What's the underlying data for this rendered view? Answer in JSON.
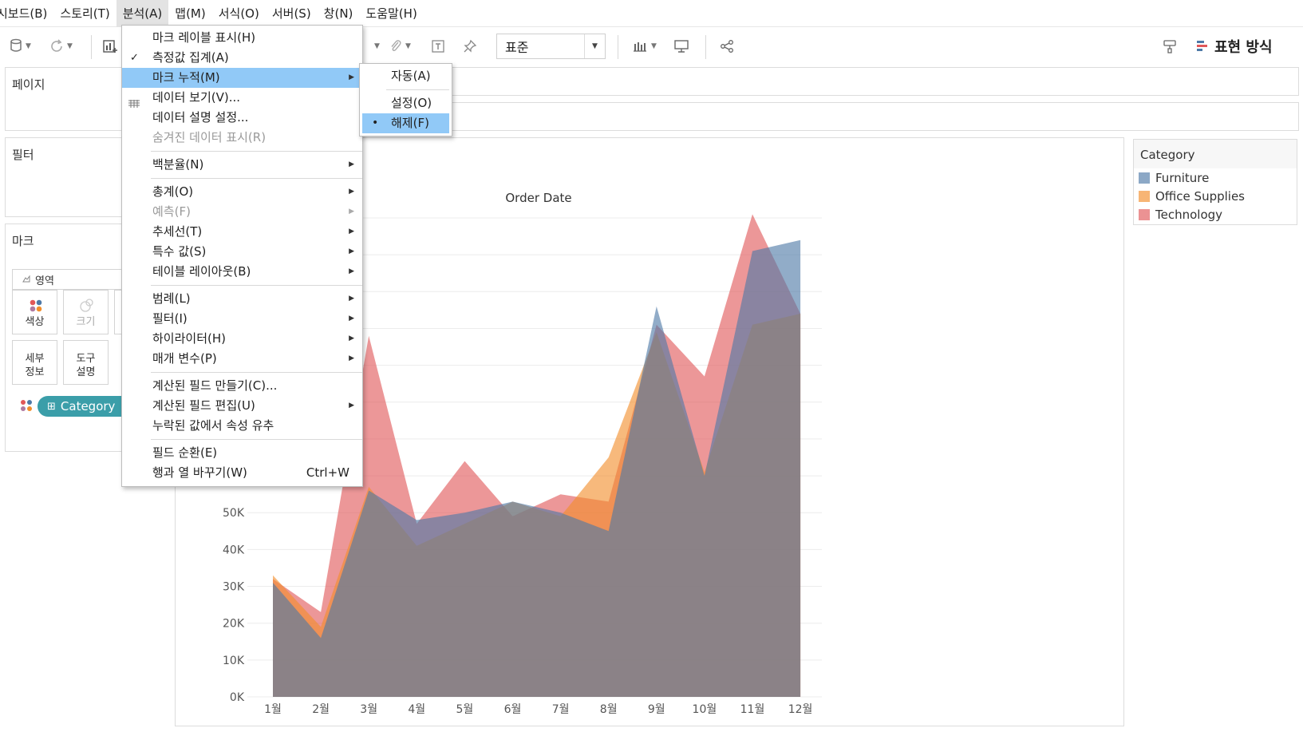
{
  "menubar": {
    "items": [
      {
        "label": "시보드(B)"
      },
      {
        "label": "스토리(T)"
      },
      {
        "label": "분석(A)"
      },
      {
        "label": "맵(M)"
      },
      {
        "label": "서식(O)"
      },
      {
        "label": "서버(S)"
      },
      {
        "label": "창(N)"
      },
      {
        "label": "도움말(H)"
      }
    ]
  },
  "toolbar": {
    "mark_size_select": "표준",
    "present_label": "표현 방식"
  },
  "panes": {
    "pages_title": "페이지",
    "filters_title": "필터",
    "marks_title": "마크",
    "mark_type": "영역",
    "cards": [
      {
        "label": "색상"
      },
      {
        "label": "크기"
      },
      {
        "label": "세부 정보"
      },
      {
        "label": "도구 설명"
      }
    ],
    "category_pill": "Category"
  },
  "analysis_menu": {
    "items": [
      {
        "label": "마크 레이블 표시(H)"
      },
      {
        "label": "측정값 집계(A)"
      },
      {
        "label": "마크 누적(M)"
      },
      {
        "label": "데이터 보기(V)..."
      },
      {
        "label": "데이터 설명 설정..."
      },
      {
        "label": "숨겨진 데이터 표시(R)"
      },
      {
        "label": "백분율(N)"
      },
      {
        "label": "총계(O)"
      },
      {
        "label": "예측(F)"
      },
      {
        "label": "추세선(T)"
      },
      {
        "label": "특수 값(S)"
      },
      {
        "label": "테이블 레이아웃(B)"
      },
      {
        "label": "범례(L)"
      },
      {
        "label": "필터(I)"
      },
      {
        "label": "하이라이터(H)"
      },
      {
        "label": "매개 변수(P)"
      },
      {
        "label": "계산된 필드 만들기(C)..."
      },
      {
        "label": "계산된 필드 편집(U)"
      },
      {
        "label": "누락된 값에서 속성 유추"
      },
      {
        "label": "필드 순환(E)"
      },
      {
        "label": "행과 열 바꾸기(W)",
        "shortcut": "Ctrl+W"
      }
    ]
  },
  "stack_submenu": {
    "items": [
      {
        "label": "자동(A)"
      },
      {
        "label": "설정(O)"
      },
      {
        "label": "해제(F)"
      }
    ]
  },
  "legend": {
    "title": "Category",
    "items": [
      {
        "label": "Furniture",
        "color": "#4e79a7"
      },
      {
        "label": "Office Supplies",
        "color": "#f28e2b"
      },
      {
        "label": "Technology",
        "color": "#e15759"
      }
    ]
  },
  "chart_data": {
    "type": "area",
    "title": "Order Date",
    "categories": [
      "1월",
      "2월",
      "3월",
      "4월",
      "5월",
      "6월",
      "7월",
      "8월",
      "9월",
      "10월",
      "11월",
      "12월"
    ],
    "ylim": [
      0,
      130000
    ],
    "y_ticks": [
      {
        "value": 0,
        "label": "0K"
      },
      {
        "value": 10000,
        "label": "10K"
      },
      {
        "value": 20000,
        "label": "20K"
      },
      {
        "value": 30000,
        "label": "30K"
      },
      {
        "value": 40000,
        "label": "40K"
      },
      {
        "value": 50000,
        "label": "50K"
      }
    ],
    "stacked": false,
    "series": [
      {
        "name": "Technology",
        "color": "#e15759",
        "values": [
          32000,
          23000,
          98000,
          47000,
          64000,
          49000,
          55000,
          53000,
          101000,
          87000,
          131000,
          104000
        ]
      },
      {
        "name": "Office Supplies",
        "color": "#f28e2b",
        "values": [
          33000,
          19000,
          57000,
          41000,
          47000,
          53000,
          49000,
          65000,
          99000,
          61000,
          101000,
          104000
        ]
      },
      {
        "name": "Furniture",
        "color": "#4e79a7",
        "values": [
          31000,
          16000,
          56000,
          48000,
          50000,
          53000,
          50000,
          45000,
          106000,
          60000,
          121000,
          124000
        ]
      }
    ]
  }
}
